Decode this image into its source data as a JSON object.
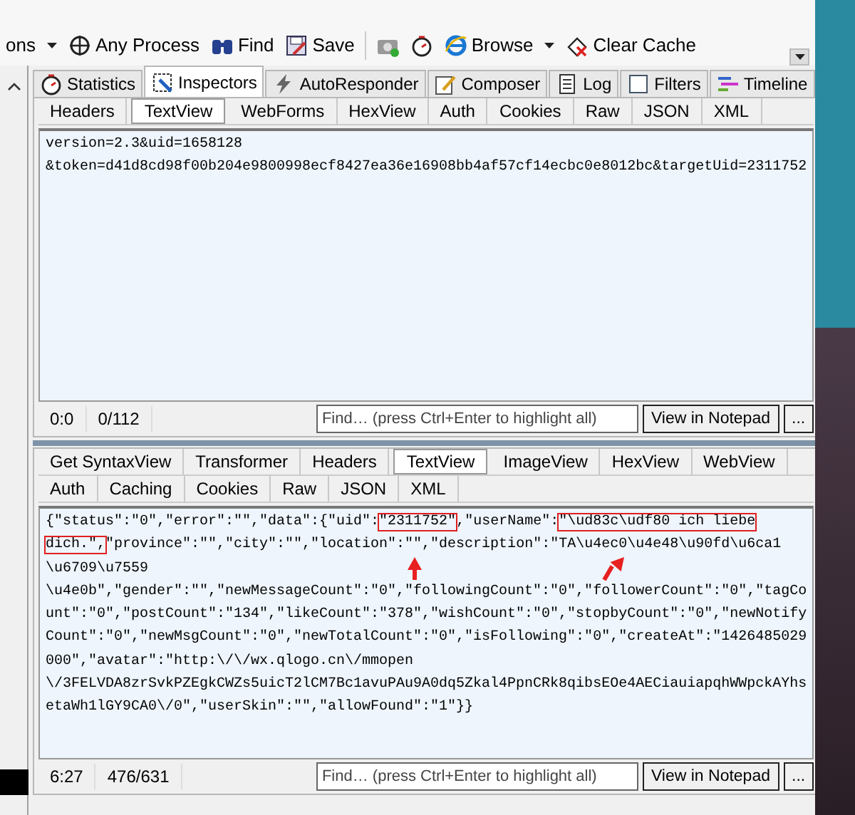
{
  "toolbar": {
    "items": [
      {
        "label": "ons",
        "caret": true
      },
      {
        "label": "Any Process",
        "caret": false
      },
      {
        "label": "Find",
        "caret": false
      },
      {
        "label": "Save",
        "caret": false
      },
      {
        "caret": false
      },
      {
        "caret": false
      },
      {
        "label": "Browse",
        "caret": true
      },
      {
        "label": "Clear Cache",
        "caret": false
      }
    ]
  },
  "main_tabs": [
    {
      "label": "Statistics",
      "selected": false
    },
    {
      "label": "Inspectors",
      "selected": true
    },
    {
      "label": "AutoResponder",
      "selected": false
    },
    {
      "label": "Composer",
      "selected": false
    },
    {
      "label": "Log",
      "selected": false
    },
    {
      "label": "Filters",
      "selected": false
    },
    {
      "label": "Timeline",
      "selected": false
    }
  ],
  "request": {
    "tab_rows": [
      [
        {
          "label": "Headers",
          "selected": false
        },
        {
          "label": "TextView",
          "selected": true
        },
        {
          "label": "WebForms",
          "selected": false
        },
        {
          "label": "HexView",
          "selected": false
        },
        {
          "label": "Auth",
          "selected": false
        },
        {
          "label": "Cookies",
          "selected": false
        },
        {
          "label": "Raw",
          "selected": false
        },
        {
          "label": "JSON",
          "selected": false
        },
        {
          "label": "XML",
          "selected": false
        }
      ]
    ],
    "body_lines": [
      [
        {
          "text": "version=2.3&uid=1658128",
          "boxed": false
        }
      ],
      [
        {
          "text": "&token=d41d8cd98f00b204e9800998ecf8427ea36e16908bb4af57cf14ecbc0e8012bc&targetUid=2311752",
          "boxed": false
        }
      ]
    ],
    "status": {
      "position": "0:0",
      "selection": "0/112"
    },
    "find": {
      "placeholder": "Find… (press Ctrl+Enter to highlight all)"
    },
    "buttons": [
      "View in Notepad",
      "..."
    ]
  },
  "response": {
    "tab_rows": [
      [
        {
          "label": "Get SyntaxView",
          "selected": false
        },
        {
          "label": "Transformer",
          "selected": false
        },
        {
          "label": "Headers",
          "selected": false
        },
        {
          "label": "TextView",
          "selected": true
        },
        {
          "label": "ImageView",
          "selected": false
        },
        {
          "label": "HexView",
          "selected": false
        },
        {
          "label": "WebView",
          "selected": false
        }
      ],
      [
        {
          "label": "Auth",
          "selected": false
        },
        {
          "label": "Caching",
          "selected": false
        },
        {
          "label": "Cookies",
          "selected": false
        },
        {
          "label": "Raw",
          "selected": false
        },
        {
          "label": "JSON",
          "selected": false
        },
        {
          "label": "XML",
          "selected": false
        }
      ]
    ],
    "body_lines": [
      [
        {
          "text": "{\"status\":\"0\",\"error\":\"\",\"data\":{\"uid\":",
          "boxed": false
        },
        {
          "text": "\"2311752\"",
          "boxed": true,
          "arrow": true
        },
        {
          "text": ",\"userName\":",
          "boxed": false
        },
        {
          "text": "\"\\ud83c\\udf80 ich liebe",
          "boxed": true,
          "arrow": true
        }
      ],
      [
        {
          "text": "dich.\",",
          "boxed": true
        },
        {
          "text": "\"province\":\"\",\"city\":\"\",\"location\":\"\",\"description\":\"TA\\u4ec0\\u4e48\\u90fd\\u6ca1",
          "boxed": false
        }
      ],
      [
        {
          "text": "\\u6709\\u7559",
          "boxed": false
        }
      ],
      [
        {
          "text": "\\u4e0b\",\"gender\":\"\",\"newMessageCount\":\"0\",\"followingCount\":\"0\",\"followerCount\":\"0\",\"tagCo",
          "boxed": false
        }
      ],
      [
        {
          "text": "unt\":\"0\",\"postCount\":\"134\",\"likeCount\":\"378\",\"wishCount\":\"0\",\"stopbyCount\":\"0\",\"newNotify",
          "boxed": false
        }
      ],
      [
        {
          "text": "Count\":\"0\",\"newMsgCount\":\"0\",\"newTotalCount\":\"0\",\"isFollowing\":\"0\",\"createAt\":\"1426485029",
          "boxed": false
        }
      ],
      [
        {
          "text": "000\",\"avatar\":\"http:\\/\\/wx.qlogo.cn\\/mmopen",
          "boxed": false
        }
      ],
      [
        {
          "text": "\\/3FELVDA8zrSvkPZEgkCWZs5uicT2lCM7Bc1avuPAu9A0dq5Zkal4PpnCRk8qibsEOe4AECiauiapqhWWpckAYhs",
          "boxed": false
        }
      ],
      [
        {
          "text": "etaWh1lGY9CA0\\/0\",\"userSkin\":\"\",\"allowFound\":\"1\"}}",
          "boxed": false
        }
      ]
    ],
    "status": {
      "position": "6:27",
      "selection": "476/631"
    },
    "find": {
      "placeholder": "Find… (press Ctrl+Enter to highlight all)"
    },
    "buttons": [
      "View in Notepad",
      "..."
    ]
  }
}
